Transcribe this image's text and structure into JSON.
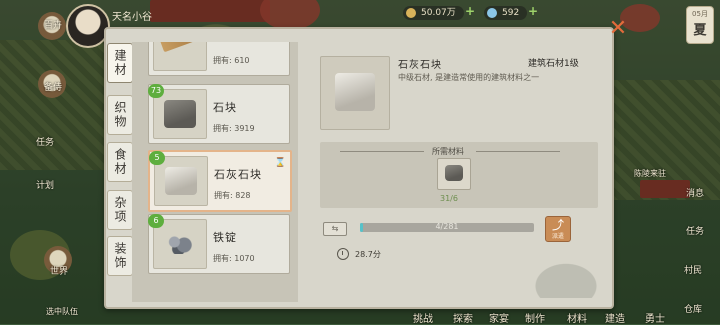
{
  "hud": {
    "player_name": "天名小谷",
    "resource1": "50.07万",
    "resource2": "592",
    "season_date": "05月",
    "season_name": "夏"
  },
  "world": {
    "left_buttons": [
      "百卉",
      "备侍",
      "任务",
      "计划",
      "世界",
      "选中队伍"
    ],
    "right_buttons": [
      "消息",
      "任务",
      "村民",
      "仓库"
    ],
    "right_label": "陈陵来驻",
    "bottom_menu": [
      "挑战",
      "探索",
      "家宴",
      "制作",
      "材料",
      "建造",
      "勇士"
    ]
  },
  "tabs": [
    {
      "label": "建材",
      "active": true
    },
    {
      "label": "织物",
      "active": false
    },
    {
      "label": "食材",
      "active": false
    },
    {
      "label": "杂项",
      "active": false
    },
    {
      "label": "装饰",
      "active": false
    }
  ],
  "items": [
    {
      "name": "",
      "owned": "拥有: 610",
      "badge": "",
      "icon": "wood"
    },
    {
      "name": "石块",
      "owned": "拥有: 3919",
      "badge": "73",
      "icon": "stone"
    },
    {
      "name": "石灰石块",
      "owned": "拥有: 828",
      "badge": "5",
      "icon": "limestone",
      "selected": true
    },
    {
      "name": "铁锭",
      "owned": "拥有: 1070",
      "badge": "6",
      "icon": "ore"
    }
  ],
  "detail": {
    "name": "石灰石块",
    "category": "建筑石材1级",
    "description": "中级石材, 是建造常使用的建筑材料之一",
    "required_title": "所需材料",
    "required_count": "31/6",
    "quantity_text": "4/281",
    "quantity_fraction": 0.014,
    "upgrade_label": "派遣",
    "time": "28.7分"
  },
  "colors": {
    "accent": "#e36b3b",
    "badge": "#5eae3e",
    "progress": "#57c2c9"
  }
}
